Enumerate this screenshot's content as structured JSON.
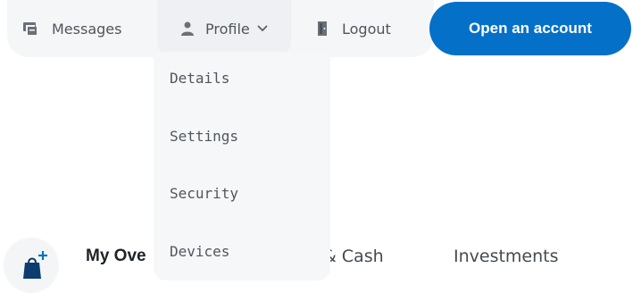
{
  "nav": {
    "messages_label": "Messages",
    "profile_label": "Profile",
    "logout_label": "Logout",
    "cta_label": "Open an account"
  },
  "profile_menu": {
    "items": [
      {
        "label": "Details"
      },
      {
        "label": "Settings"
      },
      {
        "label": "Security"
      },
      {
        "label": "Devices"
      }
    ]
  },
  "tabs": {
    "overview_label": "My Ove",
    "cash_label": "s & Cash",
    "investments_label": "Investments"
  },
  "colors": {
    "accent": "#0570c7",
    "nav_background": "#f5f6f8",
    "dropdown_background": "#f6f7f9"
  },
  "icons": {
    "messages": "messages-icon",
    "profile": "user-icon",
    "profile_toggle": "chevron-down-icon",
    "logout": "door-icon",
    "bag": "shopping-bag-plus-icon"
  }
}
